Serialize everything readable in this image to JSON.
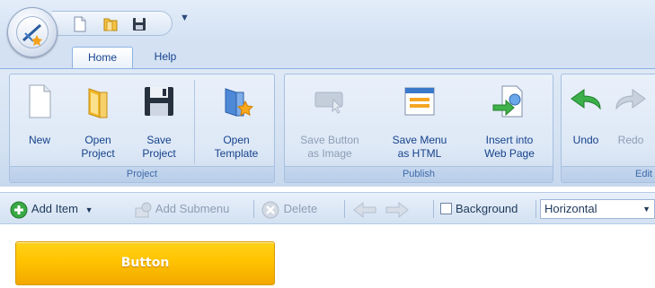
{
  "tabs": [
    "Home",
    "Help"
  ],
  "ribbon": {
    "project_group": {
      "label": "Project",
      "buttons": [
        "New",
        "Open\nProject",
        "Save\nProject",
        "Open\nTemplate"
      ]
    },
    "publish_group": {
      "label": "Publish",
      "buttons": [
        "Save Button\nas Image",
        "Save Menu\nas HTML",
        "Insert into\nWeb Page"
      ]
    },
    "edit_group": {
      "label": "Edit",
      "buttons": [
        "Undo",
        "Redo"
      ]
    }
  },
  "toolbar": {
    "add_item": "Add Item",
    "add_submenu": "Add Submenu",
    "delete": "Delete",
    "background": "Background",
    "orientation_value": "Horizontal"
  },
  "canvas": {
    "button_label": "Button",
    "button_color": "#ffc300"
  },
  "colors": {
    "ribbon_text": "#15428b",
    "ribbon_background": "#d5e2f2",
    "disabled_text": "#8d9db5"
  }
}
